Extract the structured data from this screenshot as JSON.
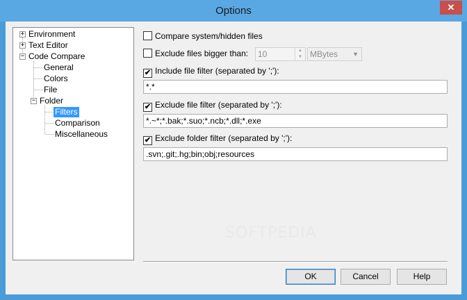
{
  "window": {
    "title": "Options",
    "close_glyph": "✕"
  },
  "tree": {
    "environment": "Environment",
    "text_editor": "Text Editor",
    "code_compare": "Code Compare",
    "general": "General",
    "colors": "Colors",
    "file": "File",
    "folder": "Folder",
    "filters": "Filters",
    "comparison": "Comparison",
    "miscellaneous": "Miscellaneous",
    "expand_glyph": "+",
    "collapse_glyph": "−"
  },
  "options": {
    "compare_hidden": {
      "label": "Compare system/hidden files",
      "checked": false
    },
    "exclude_bigger": {
      "label": "Exclude files bigger than:",
      "checked": false,
      "size_value": "10",
      "unit": "MBytes"
    },
    "include_filter": {
      "label": "Include file filter (separated by ';'):",
      "checked": true,
      "value": "*.*"
    },
    "exclude_file_filter": {
      "label": "Exclude file filter (separated by ';'):",
      "checked": true,
      "value": "*.~*;*.bak;*.suo;*.ncb;*.dll;*.exe"
    },
    "exclude_folder_filter": {
      "label": "Exclude folder filter (separated by ';'):",
      "checked": true,
      "value": ".svn;.git;.hg;bin;obj;resources"
    }
  },
  "buttons": {
    "ok": "OK",
    "cancel": "Cancel",
    "help": "Help"
  },
  "check_glyph": "✔",
  "watermark": "SOFTPEDIA"
}
